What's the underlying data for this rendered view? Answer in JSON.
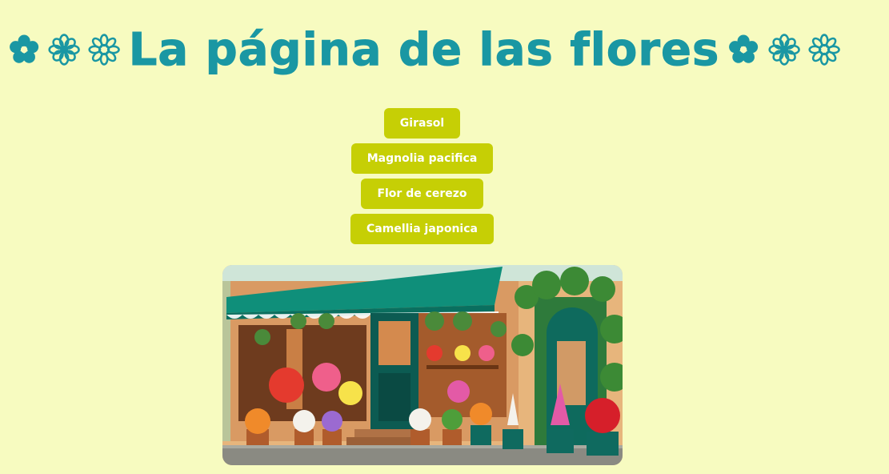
{
  "header": {
    "title": "La página de las flores",
    "left_icons": [
      "flower-icon",
      "flower-outline-icon",
      "flower-daisy-icon"
    ],
    "right_icons": [
      "flower-icon",
      "flower-outline-icon",
      "flower-daisy-icon"
    ]
  },
  "menu": {
    "items": [
      {
        "label": "Girasol"
      },
      {
        "label": "Magnolia pacifica"
      },
      {
        "label": "Flor de cerezo"
      },
      {
        "label": "Camellia japonica"
      }
    ]
  },
  "image": {
    "subject": "flower-shop-storefront"
  },
  "colors": {
    "background": "#f7fbc0",
    "title": "#1a97a3",
    "button": "#c6cf05",
    "button_text": "#ffffff"
  }
}
